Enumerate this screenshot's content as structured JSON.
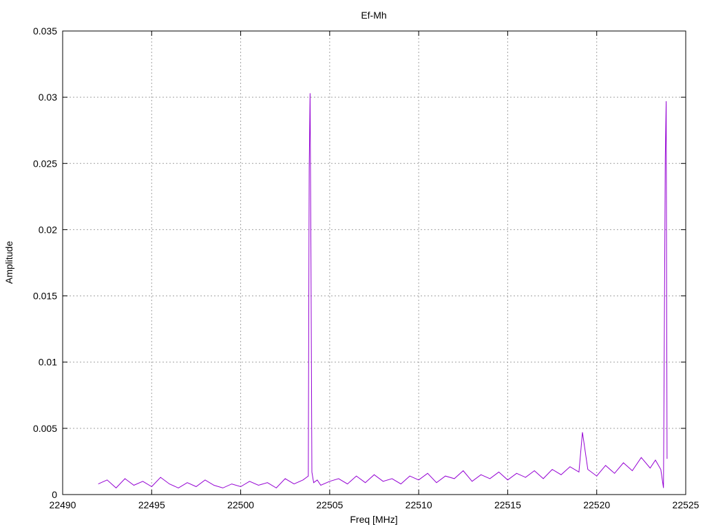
{
  "colors": {
    "series": "#9400d3",
    "grid": "#a0a0a0",
    "frame": "#000000"
  },
  "chart_data": {
    "type": "line",
    "title": "Ef-Mh",
    "xlabel": "Freq [MHz]",
    "ylabel": "Amplitude",
    "xlim": [
      22490,
      22525
    ],
    "ylim": [
      0,
      0.035
    ],
    "x_ticks": [
      "22490",
      "22495",
      "22500",
      "22505",
      "22510",
      "22515",
      "22520",
      "22525"
    ],
    "y_ticks": [
      "0",
      "0.005",
      "0.01",
      "0.015",
      "0.02",
      "0.025",
      "0.03",
      "0.035"
    ],
    "grid": true,
    "legend": "none",
    "series": [
      {
        "x": [
          22492.0,
          22492.5,
          22493.0,
          22493.5,
          22494.0,
          22494.5,
          22495.0,
          22495.5,
          22496.0,
          22496.5,
          22497.0,
          22497.5,
          22498.0,
          22498.5,
          22499.0,
          22499.5,
          22500.0,
          22500.5,
          22501.0,
          22501.5,
          22502.0,
          22502.5,
          22503.0,
          22503.5,
          22503.8,
          22503.85,
          22503.9,
          22503.95,
          22504.0,
          22504.1,
          22504.3,
          22504.5,
          22505.0,
          22505.5,
          22506.0,
          22506.5,
          22507.0,
          22507.5,
          22508.0,
          22508.5,
          22509.0,
          22509.5,
          22510.0,
          22510.5,
          22511.0,
          22511.5,
          22512.0,
          22512.5,
          22513.0,
          22513.5,
          22514.0,
          22514.5,
          22515.0,
          22515.5,
          22516.0,
          22516.5,
          22517.0,
          22517.5,
          22518.0,
          22518.5,
          22519.0,
          22519.2,
          22519.5,
          22520.0,
          22520.5,
          22521.0,
          22521.5,
          22522.0,
          22522.5,
          22523.0,
          22523.3,
          22523.6,
          22523.75,
          22523.85,
          22523.9,
          22523.95
        ],
        "y": [
          0.0008,
          0.0011,
          0.0005,
          0.0012,
          0.0007,
          0.001,
          0.0006,
          0.0013,
          0.0008,
          0.0005,
          0.0009,
          0.0006,
          0.0011,
          0.0007,
          0.0005,
          0.0008,
          0.0006,
          0.001,
          0.0007,
          0.0009,
          0.0005,
          0.0012,
          0.0008,
          0.0011,
          0.0014,
          0.0246,
          0.0303,
          0.0176,
          0.0017,
          0.0009,
          0.0011,
          0.0007,
          0.001,
          0.0012,
          0.0008,
          0.0014,
          0.0009,
          0.0015,
          0.001,
          0.0012,
          0.0008,
          0.0014,
          0.0011,
          0.0016,
          0.0009,
          0.0014,
          0.0012,
          0.0018,
          0.001,
          0.0015,
          0.0012,
          0.0017,
          0.0011,
          0.0016,
          0.0013,
          0.0018,
          0.0012,
          0.0019,
          0.0015,
          0.0021,
          0.0017,
          0.0047,
          0.0019,
          0.0014,
          0.0022,
          0.0016,
          0.0024,
          0.0018,
          0.0028,
          0.002,
          0.0026,
          0.0019,
          0.0005,
          0.0254,
          0.0297,
          0.0027
        ]
      }
    ]
  }
}
